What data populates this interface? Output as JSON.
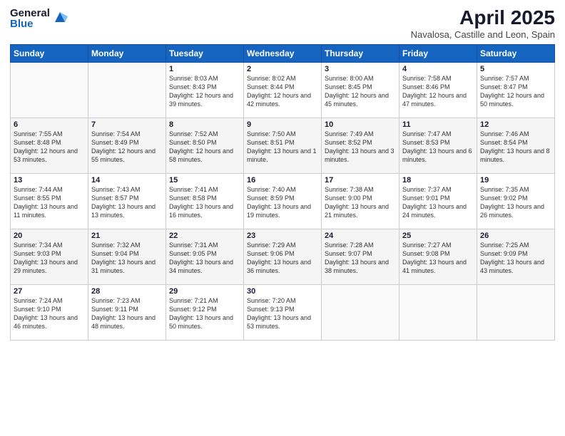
{
  "logo": {
    "general": "General",
    "blue": "Blue"
  },
  "header": {
    "month": "April 2025",
    "location": "Navalosa, Castille and Leon, Spain"
  },
  "weekdays": [
    "Sunday",
    "Monday",
    "Tuesday",
    "Wednesday",
    "Thursday",
    "Friday",
    "Saturday"
  ],
  "weeks": [
    [
      {
        "day": null,
        "info": null
      },
      {
        "day": null,
        "info": null
      },
      {
        "day": "1",
        "info": "Sunrise: 8:03 AM\nSunset: 8:43 PM\nDaylight: 12 hours and 39 minutes."
      },
      {
        "day": "2",
        "info": "Sunrise: 8:02 AM\nSunset: 8:44 PM\nDaylight: 12 hours and 42 minutes."
      },
      {
        "day": "3",
        "info": "Sunrise: 8:00 AM\nSunset: 8:45 PM\nDaylight: 12 hours and 45 minutes."
      },
      {
        "day": "4",
        "info": "Sunrise: 7:58 AM\nSunset: 8:46 PM\nDaylight: 12 hours and 47 minutes."
      },
      {
        "day": "5",
        "info": "Sunrise: 7:57 AM\nSunset: 8:47 PM\nDaylight: 12 hours and 50 minutes."
      }
    ],
    [
      {
        "day": "6",
        "info": "Sunrise: 7:55 AM\nSunset: 8:48 PM\nDaylight: 12 hours and 53 minutes."
      },
      {
        "day": "7",
        "info": "Sunrise: 7:54 AM\nSunset: 8:49 PM\nDaylight: 12 hours and 55 minutes."
      },
      {
        "day": "8",
        "info": "Sunrise: 7:52 AM\nSunset: 8:50 PM\nDaylight: 12 hours and 58 minutes."
      },
      {
        "day": "9",
        "info": "Sunrise: 7:50 AM\nSunset: 8:51 PM\nDaylight: 13 hours and 1 minute."
      },
      {
        "day": "10",
        "info": "Sunrise: 7:49 AM\nSunset: 8:52 PM\nDaylight: 13 hours and 3 minutes."
      },
      {
        "day": "11",
        "info": "Sunrise: 7:47 AM\nSunset: 8:53 PM\nDaylight: 13 hours and 6 minutes."
      },
      {
        "day": "12",
        "info": "Sunrise: 7:46 AM\nSunset: 8:54 PM\nDaylight: 13 hours and 8 minutes."
      }
    ],
    [
      {
        "day": "13",
        "info": "Sunrise: 7:44 AM\nSunset: 8:55 PM\nDaylight: 13 hours and 11 minutes."
      },
      {
        "day": "14",
        "info": "Sunrise: 7:43 AM\nSunset: 8:57 PM\nDaylight: 13 hours and 13 minutes."
      },
      {
        "day": "15",
        "info": "Sunrise: 7:41 AM\nSunset: 8:58 PM\nDaylight: 13 hours and 16 minutes."
      },
      {
        "day": "16",
        "info": "Sunrise: 7:40 AM\nSunset: 8:59 PM\nDaylight: 13 hours and 19 minutes."
      },
      {
        "day": "17",
        "info": "Sunrise: 7:38 AM\nSunset: 9:00 PM\nDaylight: 13 hours and 21 minutes."
      },
      {
        "day": "18",
        "info": "Sunrise: 7:37 AM\nSunset: 9:01 PM\nDaylight: 13 hours and 24 minutes."
      },
      {
        "day": "19",
        "info": "Sunrise: 7:35 AM\nSunset: 9:02 PM\nDaylight: 13 hours and 26 minutes."
      }
    ],
    [
      {
        "day": "20",
        "info": "Sunrise: 7:34 AM\nSunset: 9:03 PM\nDaylight: 13 hours and 29 minutes."
      },
      {
        "day": "21",
        "info": "Sunrise: 7:32 AM\nSunset: 9:04 PM\nDaylight: 13 hours and 31 minutes."
      },
      {
        "day": "22",
        "info": "Sunrise: 7:31 AM\nSunset: 9:05 PM\nDaylight: 13 hours and 34 minutes."
      },
      {
        "day": "23",
        "info": "Sunrise: 7:29 AM\nSunset: 9:06 PM\nDaylight: 13 hours and 36 minutes."
      },
      {
        "day": "24",
        "info": "Sunrise: 7:28 AM\nSunset: 9:07 PM\nDaylight: 13 hours and 38 minutes."
      },
      {
        "day": "25",
        "info": "Sunrise: 7:27 AM\nSunset: 9:08 PM\nDaylight: 13 hours and 41 minutes."
      },
      {
        "day": "26",
        "info": "Sunrise: 7:25 AM\nSunset: 9:09 PM\nDaylight: 13 hours and 43 minutes."
      }
    ],
    [
      {
        "day": "27",
        "info": "Sunrise: 7:24 AM\nSunset: 9:10 PM\nDaylight: 13 hours and 46 minutes."
      },
      {
        "day": "28",
        "info": "Sunrise: 7:23 AM\nSunset: 9:11 PM\nDaylight: 13 hours and 48 minutes."
      },
      {
        "day": "29",
        "info": "Sunrise: 7:21 AM\nSunset: 9:12 PM\nDaylight: 13 hours and 50 minutes."
      },
      {
        "day": "30",
        "info": "Sunrise: 7:20 AM\nSunset: 9:13 PM\nDaylight: 13 hours and 53 minutes."
      },
      {
        "day": null,
        "info": null
      },
      {
        "day": null,
        "info": null
      },
      {
        "day": null,
        "info": null
      }
    ]
  ]
}
